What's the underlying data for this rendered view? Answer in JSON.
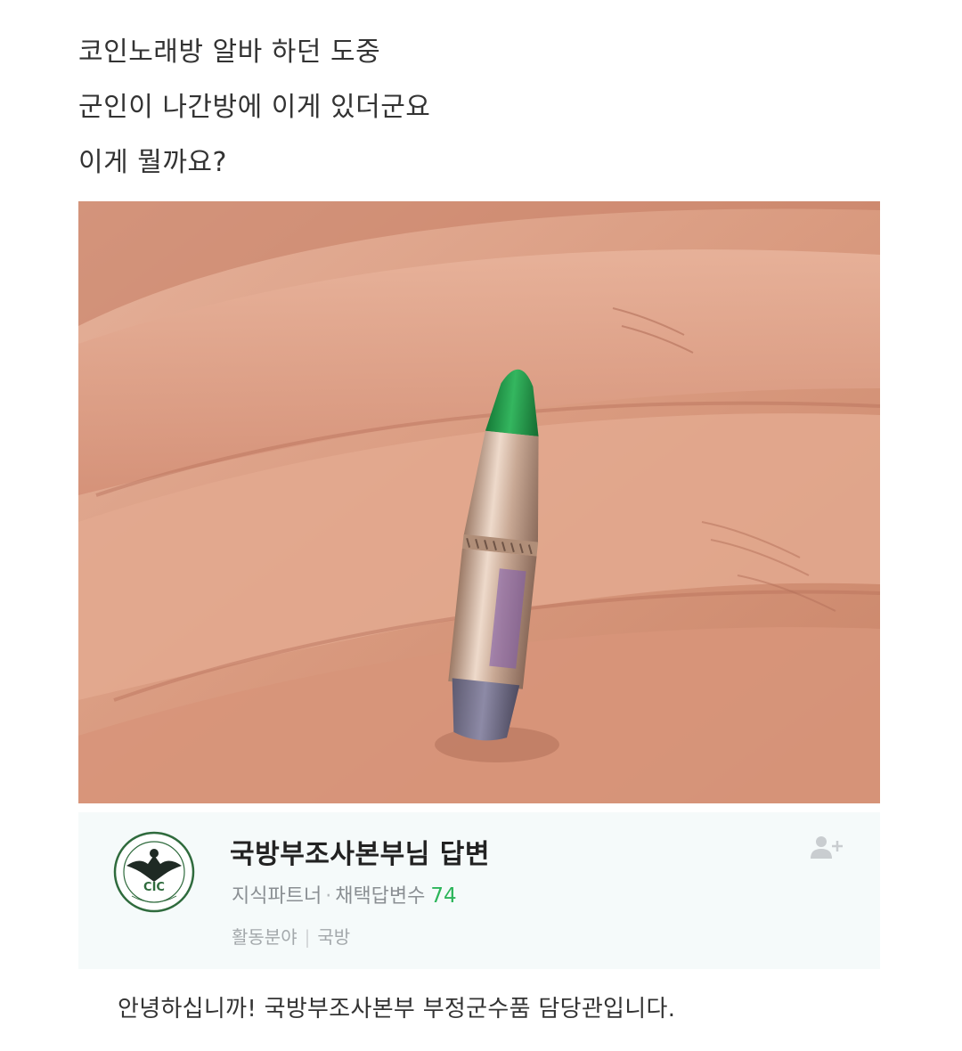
{
  "post": {
    "lines": [
      "코인노래방 알바 하던 도중",
      "군인이 나간방에 이게 있더군요",
      "이게 뭘까요?"
    ]
  },
  "photo": {
    "subject_icon": "bullet-in-palm-photo",
    "tip_color": "#1f9a4a",
    "casing_color": "#c9a88c",
    "skin_color": "#d9a086"
  },
  "answer": {
    "title": "국방부조사본부님 답변",
    "badge": "지식파트너",
    "dot": "·",
    "adopted_label": "채택답변수",
    "adopted_count": "74",
    "field_label": "활동분야",
    "field_sep": "|",
    "field_value": "국방",
    "emblem_icon": "cic-eagle-emblem",
    "emblem_text": "CIC",
    "follow_icon": "add-friend-icon",
    "accent_color": "#2cb55a"
  },
  "greeting": "안녕하십니까! 국방부조사본부 부정군수품 담당관입니다."
}
